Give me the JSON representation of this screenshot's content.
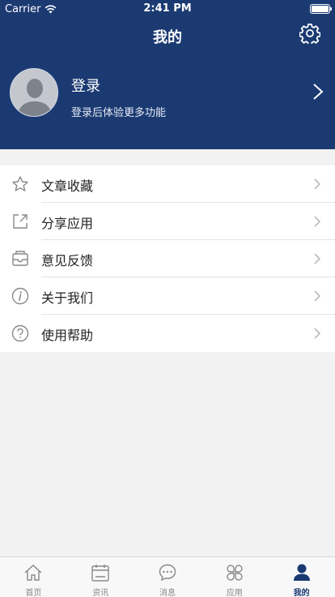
{
  "status_bar": {
    "carrier": "Carrier",
    "time": "2:41 PM"
  },
  "header": {
    "title": "我的"
  },
  "profile": {
    "login_title": "登录",
    "login_subtitle": "登录后体验更多功能"
  },
  "menu": {
    "items": [
      {
        "label": "文章收藏",
        "icon": "star-icon"
      },
      {
        "label": "分享应用",
        "icon": "share-icon"
      },
      {
        "label": "意见反馈",
        "icon": "feedback-icon"
      },
      {
        "label": "关于我们",
        "icon": "info-icon"
      },
      {
        "label": "使用帮助",
        "icon": "help-icon"
      }
    ]
  },
  "tabbar": {
    "items": [
      {
        "label": "首页",
        "icon": "home-icon",
        "active": false
      },
      {
        "label": "资讯",
        "icon": "calendar-icon",
        "active": false
      },
      {
        "label": "消息",
        "icon": "message-icon",
        "active": false
      },
      {
        "label": "应用",
        "icon": "apps-icon",
        "active": false
      },
      {
        "label": "我的",
        "icon": "person-icon",
        "active": true
      }
    ]
  },
  "colors": {
    "primary": "#1b3a72",
    "background": "#f2f2f2",
    "icon_gray": "#888888"
  }
}
